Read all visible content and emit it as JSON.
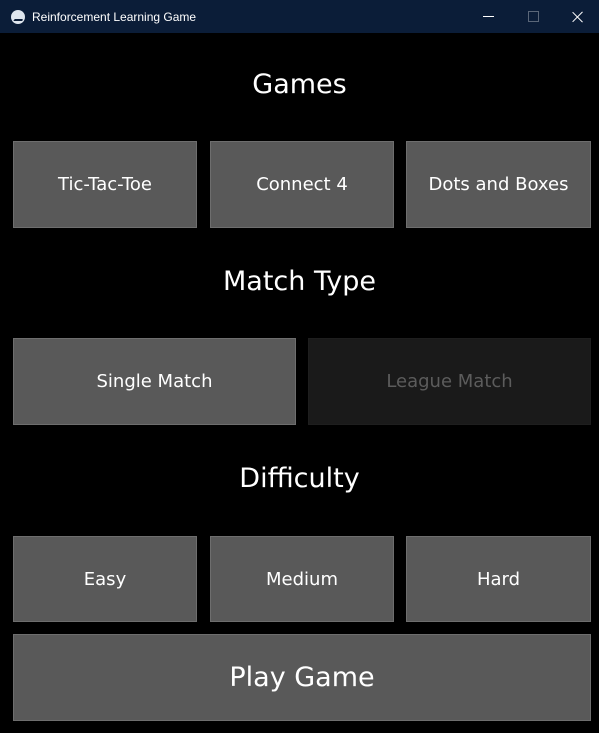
{
  "window": {
    "title": "Reinforcement Learning Game",
    "icon": "app-logo-icon",
    "controls": [
      "minimize-icon",
      "maximize-icon",
      "close-icon"
    ]
  },
  "sections": {
    "games": {
      "heading": "Games",
      "options": [
        "Tic-Tac-Toe",
        "Connect 4",
        "Dots and Boxes"
      ]
    },
    "match_type": {
      "heading": "Match Type",
      "options": [
        "Single Match",
        "League Match"
      ],
      "disabled": [
        "League Match"
      ]
    },
    "difficulty": {
      "heading": "Difficulty",
      "options": [
        "Easy",
        "Medium",
        "Hard"
      ]
    }
  },
  "play_button": {
    "label": "Play Game"
  },
  "colors": {
    "background": "#000000",
    "titlebar": "#0b1d38",
    "button": "#595959",
    "button_disabled": "#1a1a1a",
    "text": "#ffffff",
    "text_disabled": "#5c5c5c"
  }
}
